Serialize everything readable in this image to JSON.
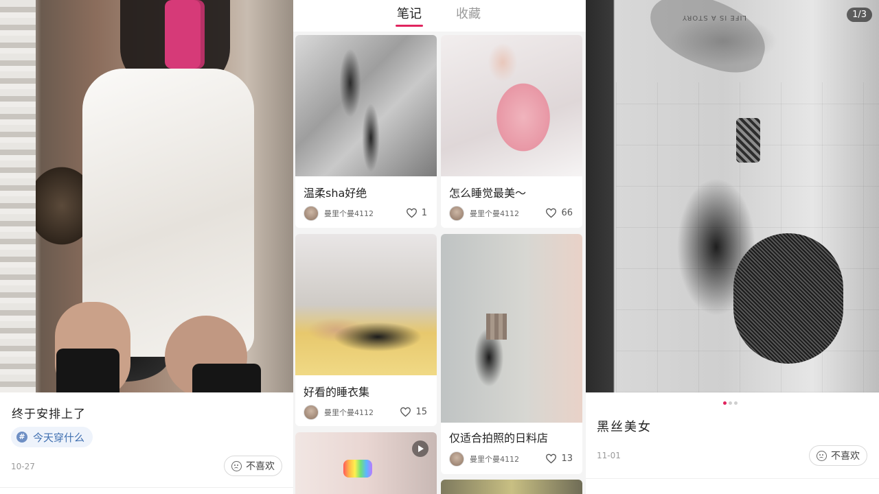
{
  "left_post": {
    "title": "终于安排上了",
    "tag": "今天穿什么",
    "date": "10-27",
    "dislike_label": "不喜欢"
  },
  "profile_tabs": {
    "tabs": [
      {
        "label": "笔记",
        "active": true
      },
      {
        "label": "收藏",
        "active": false
      }
    ],
    "accent_color": "#e0245e"
  },
  "notes": [
    {
      "title": "温柔sha好绝",
      "user": "曼里个曼4112",
      "likes": "1"
    },
    {
      "title": "怎么睡觉最美～",
      "user": "曼里个曼4112",
      "likes": "66"
    },
    {
      "title": "好看的睡衣集",
      "user": "曼里个曼4112",
      "likes": "15"
    },
    {
      "title": "仅适合拍照的日料店",
      "user": "曼里个曼4112",
      "likes": "13"
    }
  ],
  "right_post": {
    "image_counter": "1/3",
    "scene_text": "LIFE IS A STORY",
    "carousel": {
      "total": 3,
      "current": 1
    },
    "title": "黑丝美女",
    "date": "11-01",
    "dislike_label": "不喜欢"
  }
}
